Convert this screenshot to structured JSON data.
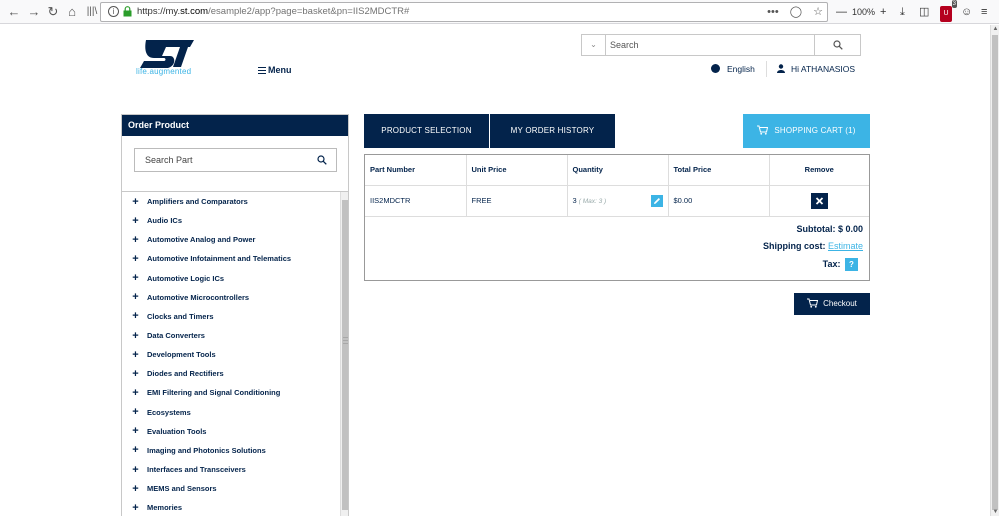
{
  "browser": {
    "url_prefix": "https://my.",
    "url_host": "st.com",
    "url_rest": "/esample2/app?page=basket&pn=IIS2MDCTR#",
    "zoom": "100%",
    "ext_badge_count": "3"
  },
  "header": {
    "logo_tagline": "life.augmented",
    "menu_label": "Menu",
    "search_placeholder": "Search",
    "language": "English",
    "greeting": "Hi ATHANASIOS"
  },
  "sidebar": {
    "title": "Order Product",
    "search_placeholder": "Search Part",
    "categories": [
      "Amplifiers and Comparators",
      "Audio ICs",
      "Automotive Analog and Power",
      "Automotive Infotainment and Telematics",
      "Automotive Logic ICs",
      "Automotive Microcontrollers",
      "Clocks and Timers",
      "Data Converters",
      "Development Tools",
      "Diodes and Rectifiers",
      "EMI Filtering and Signal Conditioning",
      "Ecosystems",
      "Evaluation Tools",
      "Imaging and Photonics Solutions",
      "Interfaces and Transceivers",
      "MEMS and Sensors",
      "Memories"
    ]
  },
  "tabs": {
    "product_selection": "PRODUCT SELECTION",
    "order_history": "MY ORDER HISTORY",
    "shopping_cart": "SHOPPING CART (1)"
  },
  "cart": {
    "columns": [
      "Part Number",
      "Unit Price",
      "Quantity",
      "Total Price",
      "Remove"
    ],
    "rows": [
      {
        "part_number": "IIS2MDCTR",
        "unit_price": "FREE",
        "quantity": "3",
        "max_note": "( Max: 3 )",
        "total_price": "$0.00"
      }
    ],
    "subtotal_label": "Subtotal: $ 0.00",
    "shipping_label": "Shipping cost:",
    "shipping_link": "Estimate",
    "tax_label": "Tax:",
    "tax_help": "?"
  },
  "checkout_label": "Checkout",
  "colors": {
    "navy": "#03234b",
    "accent": "#3cb4e5"
  }
}
